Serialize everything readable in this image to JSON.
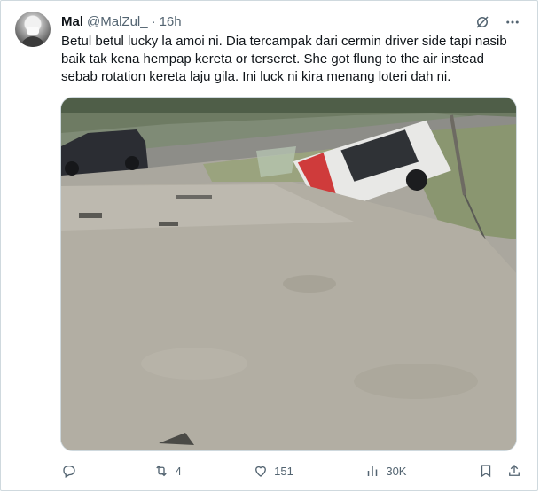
{
  "tweet": {
    "name": "Mal",
    "handle": "@MalZul_",
    "separator": "·",
    "time": "16h",
    "text": "Betul betul lucky la amoi ni. Dia tercampak dari cermin driver side tapi nasib baik tak kena hempap kereta or terseret. She got flung to the air instead sebab rotation kereta laju gila. Ini luck ni kira menang loteri dah ni."
  },
  "actions": {
    "reply_count": "",
    "retweet_count": "4",
    "like_count": "151",
    "views_count": "30K"
  },
  "icons": {
    "grok": "grok-icon",
    "more": "more-icon",
    "reply": "reply-icon",
    "retweet": "retweet-icon",
    "like": "like-icon",
    "views": "views-icon",
    "bookmark": "bookmark-icon",
    "share": "share-icon"
  },
  "colors": {
    "text": "#0f1419",
    "muted": "#536471",
    "border": "#cfd9de"
  }
}
